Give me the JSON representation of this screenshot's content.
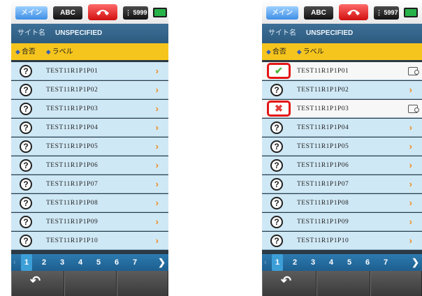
{
  "status_bar": {
    "main_label": "メイン",
    "abc_label": "ABC",
    "memory_left": "5999",
    "memory_right": "5997"
  },
  "site": {
    "label": "サイト名",
    "value": "UNSPECIFIED"
  },
  "sort": {
    "pass_fail": "合否",
    "label": "ラベル"
  },
  "rows": [
    "TEST11R1P1P01",
    "TEST11R1P1P02",
    "TEST11R1P1P03",
    "TEST11R1P1P04",
    "TEST11R1P1P05",
    "TEST11R1P1P06",
    "TEST11R1P1P07",
    "TEST11R1P1P08",
    "TEST11R1P1P09",
    "TEST11R1P1P10"
  ],
  "right_row_status": {
    "0": "pass",
    "2": "fail"
  },
  "pager": {
    "pages": [
      "1",
      "2",
      "3",
      "4",
      "5",
      "6",
      "7"
    ],
    "current": "1"
  },
  "icons": {
    "unknown": "question-icon",
    "pass": "checkmark-icon",
    "fail": "cross-icon",
    "next": "chevron-right-icon",
    "back": "back-arrow-icon",
    "hangup": "phone-hangup-icon"
  }
}
